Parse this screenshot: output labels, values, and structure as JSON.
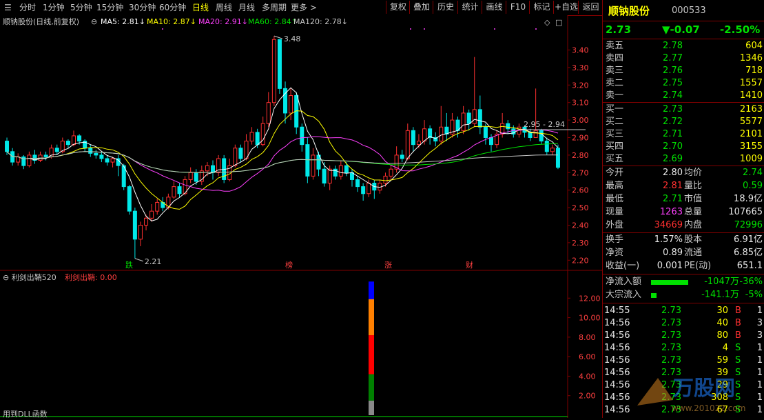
{
  "toolbar": {
    "periods": [
      "分时",
      "1分钟",
      "5分钟",
      "15分钟",
      "30分钟",
      "60分钟",
      "日线",
      "周线",
      "月线",
      "多周期",
      "更多 >"
    ],
    "active_period": "日线",
    "buttons": [
      "复权",
      "叠加",
      "历史",
      "统计",
      "画线",
      "F10",
      "标记",
      "+自选",
      "返回"
    ]
  },
  "chart_header": {
    "stock_label": "顺钠股份(日线,前复权)",
    "ma_items": [
      {
        "label": "MA5: 2.81↓",
        "color": "#ffffff"
      },
      {
        "label": "MA10: 2.87↓",
        "color": "#ffff00"
      },
      {
        "label": "MA20: 2.91↓",
        "color": "#ff40ff"
      },
      {
        "label": "MA60: 2.84↑",
        "color": "#00e000"
      },
      {
        "label": "MA120: 2.78↓",
        "color": "#c8c8c8"
      }
    ]
  },
  "price_axis": [
    "3.40",
    "3.30",
    "3.20",
    "3.10",
    "3.00",
    "2.90",
    "2.80",
    "2.70",
    "2.60",
    "2.50",
    "2.40",
    "2.30",
    "2.20"
  ],
  "annotations": {
    "high": "3.48",
    "low": "2.21",
    "range": "2.95 - 2.94"
  },
  "event_markers": [
    "跌",
    "榜",
    "涨",
    "财"
  ],
  "indicator": {
    "title": "利剑出鞘520",
    "value_label": "利剑出鞘: 0.00",
    "axis": [
      "12.00",
      "10.00",
      "8.00",
      "6.00",
      "4.00",
      "2.00"
    ],
    "footer": "用到DLL函数"
  },
  "chart_data": {
    "type": "candlestick",
    "ylim": [
      2.15,
      3.52
    ],
    "series": [
      {
        "name": "MA5",
        "color": "#ffffff"
      },
      {
        "name": "MA10",
        "color": "#ffff00"
      },
      {
        "name": "MA20",
        "color": "#ff40ff"
      },
      {
        "name": "MA60",
        "color": "#00e000"
      },
      {
        "name": "MA120",
        "color": "#c8c8c8"
      }
    ],
    "candles": [
      [
        2.88,
        2.82,
        2.9,
        2.8
      ],
      [
        2.82,
        2.76,
        2.84,
        2.74
      ],
      [
        2.76,
        2.79,
        2.81,
        2.74
      ],
      [
        2.79,
        2.74,
        2.8,
        2.72
      ],
      [
        2.74,
        2.8,
        2.82,
        2.73
      ],
      [
        2.8,
        2.77,
        2.83,
        2.75
      ],
      [
        2.77,
        2.8,
        2.82,
        2.76
      ],
      [
        2.8,
        2.79,
        2.82,
        2.77
      ],
      [
        2.79,
        2.84,
        2.86,
        2.78
      ],
      [
        2.84,
        2.82,
        2.86,
        2.8
      ],
      [
        2.82,
        2.88,
        2.9,
        2.81
      ],
      [
        2.88,
        2.86,
        2.89,
        2.84
      ],
      [
        2.86,
        2.91,
        2.94,
        2.85
      ],
      [
        2.91,
        2.88,
        2.92,
        2.86
      ],
      [
        2.88,
        2.84,
        2.89,
        2.82
      ],
      [
        2.84,
        2.81,
        2.86,
        2.79
      ],
      [
        2.81,
        2.8,
        2.83,
        2.78
      ],
      [
        2.8,
        2.78,
        2.82,
        2.76
      ],
      [
        2.78,
        2.76,
        2.8,
        2.74
      ],
      [
        2.76,
        2.78,
        2.79,
        2.73
      ],
      [
        2.78,
        2.74,
        2.8,
        2.68
      ],
      [
        2.74,
        2.62,
        2.75,
        2.6
      ],
      [
        2.62,
        2.48,
        2.63,
        2.46
      ],
      [
        2.48,
        2.32,
        2.5,
        2.21
      ],
      [
        2.32,
        2.4,
        2.42,
        2.28
      ],
      [
        2.4,
        2.44,
        2.46,
        2.37
      ],
      [
        2.44,
        2.48,
        2.52,
        2.42
      ],
      [
        2.48,
        2.53,
        2.55,
        2.46
      ],
      [
        2.53,
        2.5,
        2.56,
        2.48
      ],
      [
        2.5,
        2.56,
        2.58,
        2.49
      ],
      [
        2.56,
        2.62,
        2.65,
        2.55
      ],
      [
        2.62,
        2.58,
        2.64,
        2.56
      ],
      [
        2.58,
        2.66,
        2.68,
        2.57
      ],
      [
        2.66,
        2.7,
        2.73,
        2.64
      ],
      [
        2.7,
        2.65,
        2.72,
        2.63
      ],
      [
        2.65,
        2.71,
        2.74,
        2.63
      ],
      [
        2.71,
        2.74,
        2.76,
        2.68
      ],
      [
        2.74,
        2.7,
        2.77,
        2.66
      ],
      [
        2.7,
        2.78,
        2.8,
        2.68
      ],
      [
        2.78,
        2.66,
        2.8,
        2.64
      ],
      [
        2.66,
        2.74,
        2.78,
        2.65
      ],
      [
        2.74,
        2.84,
        2.86,
        2.73
      ],
      [
        2.84,
        2.78,
        2.86,
        2.76
      ],
      [
        2.78,
        2.88,
        2.92,
        2.77
      ],
      [
        2.88,
        2.93,
        2.96,
        2.86
      ],
      [
        2.93,
        2.86,
        2.95,
        2.84
      ],
      [
        2.86,
        2.98,
        3.02,
        2.85
      ],
      [
        2.98,
        3.1,
        3.16,
        2.96
      ],
      [
        3.1,
        3.46,
        3.48,
        3.08
      ],
      [
        3.46,
        3.18,
        3.4,
        3.15
      ],
      [
        3.18,
        3.04,
        3.22,
        2.98
      ],
      [
        3.04,
        3.14,
        3.18,
        3.0
      ],
      [
        3.14,
        2.96,
        3.16,
        2.92
      ],
      [
        2.96,
        2.86,
        2.98,
        2.82
      ],
      [
        2.86,
        2.68,
        2.9,
        2.64
      ],
      [
        2.68,
        2.8,
        2.84,
        2.66
      ],
      [
        2.8,
        2.72,
        2.82,
        2.68
      ],
      [
        2.72,
        2.64,
        2.76,
        2.62
      ],
      [
        2.64,
        2.72,
        2.74,
        2.6
      ],
      [
        2.72,
        2.68,
        2.74,
        2.66
      ],
      [
        2.68,
        2.74,
        2.77,
        2.66
      ],
      [
        2.74,
        2.7,
        2.76,
        2.68
      ],
      [
        2.7,
        2.66,
        2.72,
        2.62
      ],
      [
        2.66,
        2.62,
        2.68,
        2.59
      ],
      [
        2.62,
        2.58,
        2.64,
        2.54
      ],
      [
        2.58,
        2.64,
        2.66,
        2.56
      ],
      [
        2.64,
        2.6,
        2.66,
        2.55
      ],
      [
        2.6,
        2.64,
        2.66,
        2.58
      ],
      [
        2.64,
        2.68,
        2.7,
        2.62
      ],
      [
        2.68,
        2.72,
        2.74,
        2.66
      ],
      [
        2.72,
        2.8,
        2.85,
        2.7
      ],
      [
        2.8,
        2.78,
        2.83,
        2.76
      ],
      [
        2.78,
        2.94,
        2.98,
        2.77
      ],
      [
        2.94,
        2.86,
        2.96,
        2.82
      ],
      [
        2.86,
        2.88,
        2.92,
        2.84
      ],
      [
        2.88,
        2.95,
        3.0,
        2.86
      ],
      [
        2.95,
        2.9,
        2.97,
        2.86
      ],
      [
        2.9,
        2.88,
        2.93,
        2.85
      ],
      [
        2.88,
        2.96,
        3.08,
        2.86
      ],
      [
        2.96,
        2.92,
        3.04,
        2.88
      ],
      [
        2.92,
        3.0,
        3.04,
        2.9
      ],
      [
        3.0,
        2.94,
        3.02,
        2.9
      ],
      [
        2.94,
        3.04,
        3.08,
        2.92
      ],
      [
        3.04,
        2.98,
        3.06,
        2.94
      ],
      [
        2.98,
        3.06,
        3.36,
        2.96
      ],
      [
        3.06,
        2.96,
        3.14,
        2.92
      ],
      [
        2.96,
        2.9,
        2.98,
        2.86
      ],
      [
        2.9,
        2.86,
        2.92,
        2.82
      ],
      [
        2.86,
        2.92,
        2.94,
        2.84
      ],
      [
        2.92,
        2.98,
        3.04,
        2.9
      ],
      [
        2.98,
        2.95,
        3.0,
        2.92
      ],
      [
        2.95,
        2.92,
        2.97,
        2.9
      ],
      [
        2.92,
        2.96,
        2.98,
        2.9
      ],
      [
        2.96,
        2.93,
        2.97,
        2.9
      ],
      [
        2.93,
        2.9,
        2.95,
        2.88
      ],
      [
        2.9,
        2.94,
        3.18,
        2.9
      ],
      [
        2.94,
        2.88,
        2.95,
        2.86
      ],
      [
        2.88,
        2.82,
        2.9,
        2.8
      ],
      [
        2.82,
        2.84,
        2.86,
        2.8
      ],
      [
        2.84,
        2.73,
        2.86,
        2.72
      ]
    ],
    "indicator_bar": {
      "x_index": 96,
      "segments": [
        {
          "to": 1.5,
          "color": "#888888"
        },
        {
          "to": 4.2,
          "color": "#008000"
        },
        {
          "to": 8.2,
          "color": "#ff0000"
        },
        {
          "to": 11.9,
          "color": "#ff8000"
        },
        {
          "to": 13.7,
          "color": "#0000ff"
        }
      ],
      "ylim": [
        0,
        14
      ]
    }
  },
  "quote": {
    "name": "顺钠股份",
    "code": "000533",
    "price": "2.73",
    "change": "▼-0.07",
    "pct": "-2.50%",
    "asks": [
      {
        "label": "卖五",
        "price": "2.78",
        "vol": "604"
      },
      {
        "label": "卖四",
        "price": "2.77",
        "vol": "1346"
      },
      {
        "label": "卖三",
        "price": "2.76",
        "vol": "718"
      },
      {
        "label": "卖二",
        "price": "2.75",
        "vol": "1557"
      },
      {
        "label": "卖一",
        "price": "2.74",
        "vol": "1410"
      }
    ],
    "bids": [
      {
        "label": "买一",
        "price": "2.73",
        "vol": "2163"
      },
      {
        "label": "买二",
        "price": "2.72",
        "vol": "5577"
      },
      {
        "label": "买三",
        "price": "2.71",
        "vol": "2101"
      },
      {
        "label": "买四",
        "price": "2.70",
        "vol": "3155"
      },
      {
        "label": "买五",
        "price": "2.69",
        "vol": "1009"
      }
    ],
    "stats": [
      {
        "l1": "今开",
        "v1": "2.80",
        "c1": "white",
        "l2": "均价",
        "v2": "2.74",
        "c2": "green"
      },
      {
        "l1": "最高",
        "v1": "2.81",
        "c1": "red",
        "l2": "量比",
        "v2": "0.59",
        "c2": "green"
      },
      {
        "l1": "最低",
        "v1": "2.71",
        "c1": "green",
        "l2": "市值",
        "v2": "18.9亿",
        "c2": "white"
      },
      {
        "l1": "现量",
        "v1": "1263",
        "c1": "magenta",
        "l2": "总量",
        "v2": "107665",
        "c2": "white"
      },
      {
        "l1": "外盘",
        "v1": "34669",
        "c1": "red",
        "l2": "内盘",
        "v2": "72996",
        "c2": "green"
      }
    ],
    "stats2": [
      {
        "l1": "换手",
        "v1": "1.57%",
        "l2": "股本",
        "v2": "6.91亿"
      },
      {
        "l1": "净资",
        "v1": "0.89",
        "l2": "流通",
        "v2": "6.85亿"
      },
      {
        "l1": "收益(一)",
        "v1": "0.001",
        "l2": "PE(动)",
        "v2": "651.1"
      }
    ],
    "flows": [
      {
        "label": "净流入额",
        "value": "-1047万",
        "pct": "-36%",
        "bar": 0.36
      },
      {
        "label": "大宗流入",
        "value": "-141.1万",
        "pct": "-5%",
        "bar": 0.05
      }
    ],
    "ticks": [
      {
        "time": "14:55",
        "price": "2.73",
        "vol": "30",
        "side": "B",
        "n": "1"
      },
      {
        "time": "14:56",
        "price": "2.73",
        "vol": "40",
        "side": "B",
        "n": "3"
      },
      {
        "time": "14:56",
        "price": "2.73",
        "vol": "80",
        "side": "B",
        "n": "3"
      },
      {
        "time": "14:56",
        "price": "2.73",
        "vol": "4",
        "side": "S",
        "n": "1"
      },
      {
        "time": "14:56",
        "price": "2.73",
        "vol": "59",
        "side": "S",
        "n": "1"
      },
      {
        "time": "14:56",
        "price": "2.73",
        "vol": "39",
        "side": "S",
        "n": "1"
      },
      {
        "time": "14:56",
        "price": "2.73",
        "vol": "29",
        "side": "S",
        "n": "1"
      },
      {
        "time": "14:56",
        "price": "2.73",
        "vol": "308",
        "side": "S",
        "n": "1"
      },
      {
        "time": "14:56",
        "price": "2.73",
        "vol": "67",
        "side": "S",
        "n": "1"
      }
    ]
  },
  "watermark": {
    "text": "万股网",
    "sub": "www.201022.com"
  }
}
